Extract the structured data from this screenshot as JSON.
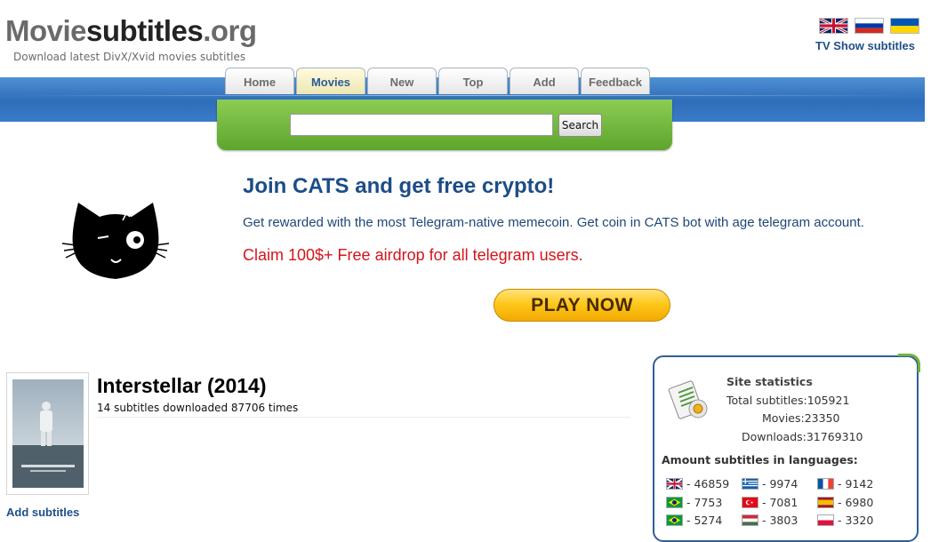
{
  "header": {
    "logo": {
      "part1": "Movie",
      "part2": "subtitles",
      "part3": ".org"
    },
    "tagline": "Download latest DivX/Xvid movies subtitles",
    "language_flags": [
      "uk-flag-icon",
      "russia-flag-icon",
      "ukraine-flag-icon"
    ],
    "tv_link": "TV Show subtitles"
  },
  "nav": {
    "tabs": [
      {
        "label": "Home"
      },
      {
        "label": "Movies",
        "active": true
      },
      {
        "label": "New"
      },
      {
        "label": "Top"
      },
      {
        "label": "Add"
      },
      {
        "label": "Feedback"
      }
    ]
  },
  "search": {
    "value": "",
    "button": "Search"
  },
  "ad": {
    "title": "Join CATS and get free crypto!",
    "text": "Get rewarded with the most Telegram-native memecoin. Get coin in CATS bot with age telegram account.",
    "claim": "Claim 100$+ Free airdrop for all telegram users.",
    "cta": "PLAY NOW"
  },
  "movie": {
    "title": "Interstellar (2014)",
    "summary": "14 subtitles downloaded 87706 times",
    "add_link": "Add subtitles"
  },
  "stats": {
    "title": "Site statistics",
    "total": "Total subtitles:105921",
    "movies": "Movies:23350",
    "downloads": "Downloads:31769310",
    "lang_title": "Amount subtitles in languages:",
    "languages": [
      {
        "flag": "uk-flag-icon",
        "count": "- 46859"
      },
      {
        "flag": "greece-flag-icon",
        "count": "- 9974"
      },
      {
        "flag": "france-flag-icon",
        "count": "- 9142"
      },
      {
        "flag": "brazil-flag-icon",
        "count": "- 7753"
      },
      {
        "flag": "turkey-flag-icon",
        "count": "- 7081"
      },
      {
        "flag": "spain-flag-icon",
        "count": "- 6980"
      },
      {
        "flag": "brazil-flag-icon",
        "count": "- 5274"
      },
      {
        "flag": "hungary-flag-icon",
        "count": "- 3803"
      },
      {
        "flag": "poland-flag-icon",
        "count": "- 3320"
      }
    ]
  },
  "colors": {
    "nav_blue": "#2e6db8",
    "search_green": "#6fb43c",
    "link_blue": "#1f4f8a",
    "ad_red": "#d4141b"
  }
}
